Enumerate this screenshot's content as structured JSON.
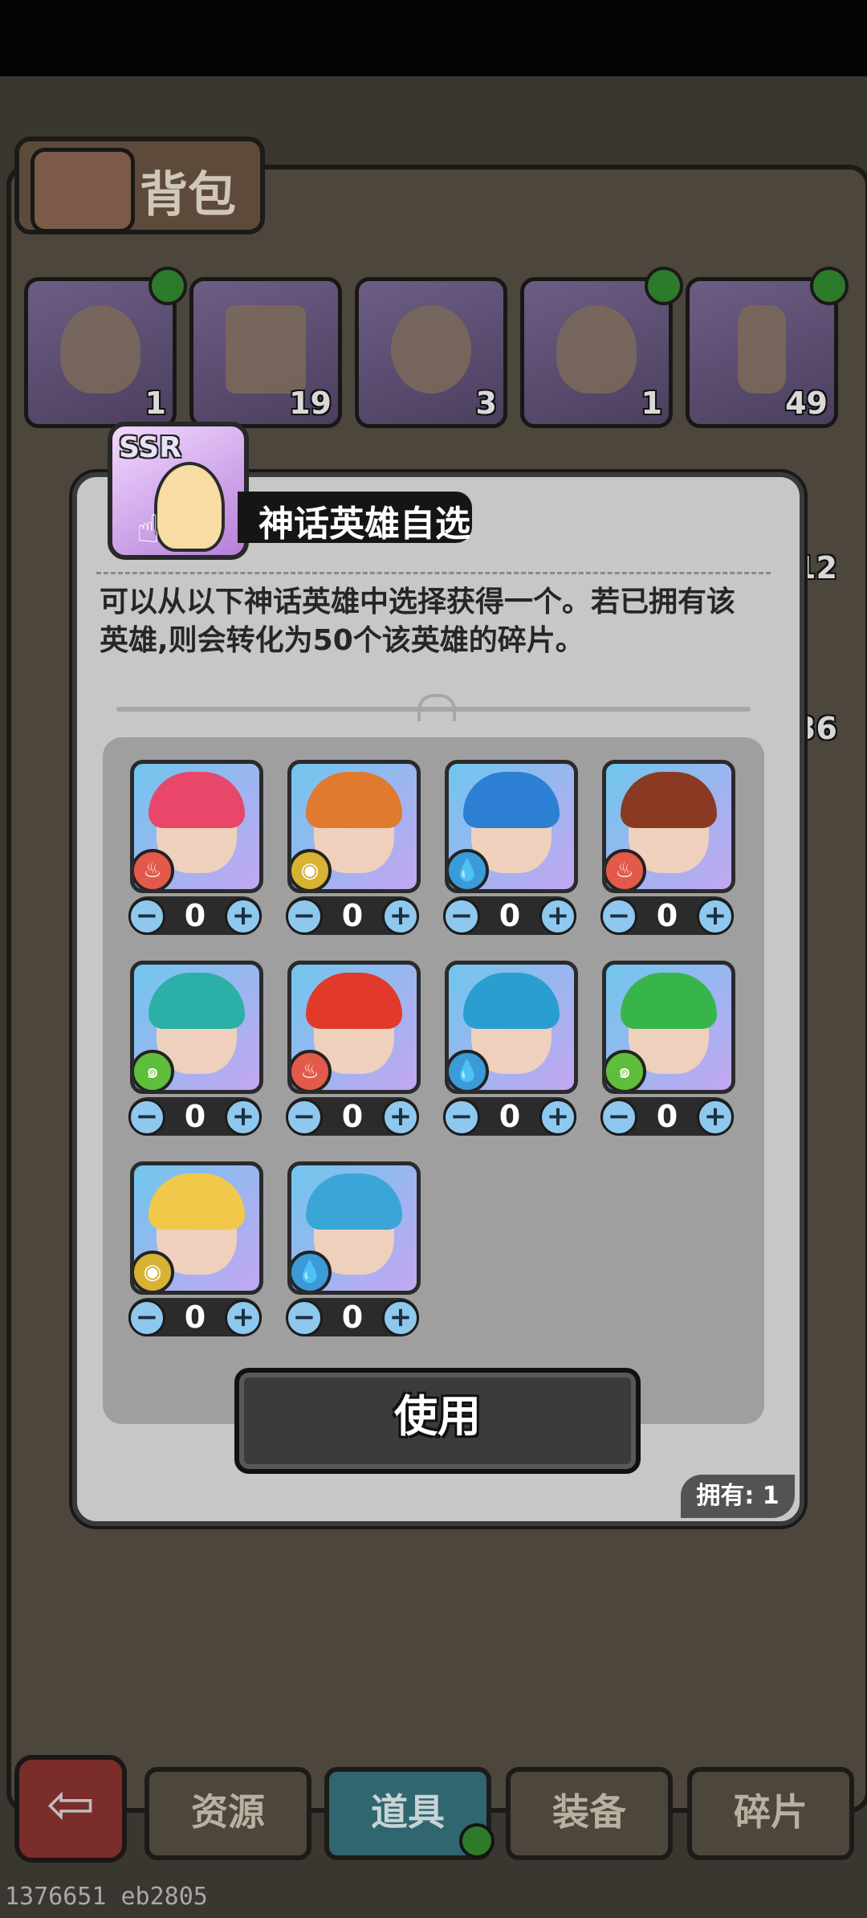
{
  "bag": {
    "title": "背包",
    "items": [
      {
        "count": "1"
      },
      {
        "count": "19"
      },
      {
        "count": "3"
      },
      {
        "count": "1"
      },
      {
        "count": "49"
      }
    ],
    "side_counts": [
      "12",
      "36"
    ]
  },
  "nav": {
    "back_icon": "back-arrow-icon",
    "tabs": [
      "资源",
      "道具",
      "装备",
      "碎片"
    ],
    "active_tab": "道具"
  },
  "dialog": {
    "badge": "SSR",
    "title": "神话英雄自选",
    "description": "可以从以下神话英雄中选择获得一个。若已拥有该英雄,则会转化为50个该英雄的碎片。",
    "use_button": "使用",
    "owned": "拥有: 1",
    "heroes": [
      {
        "element": "fire",
        "element_icon": "flame",
        "hair_color": "#e8476a",
        "quantity": "0"
      },
      {
        "element": "earth",
        "element_icon": "rock",
        "hair_color": "#e07a2e",
        "quantity": "0"
      },
      {
        "element": "water",
        "element_icon": "droplet",
        "hair_color": "#2d7fd3",
        "quantity": "0"
      },
      {
        "element": "fire",
        "element_icon": "flame",
        "hair_color": "#8a3a22",
        "quantity": "0"
      },
      {
        "element": "wind",
        "element_icon": "swirl",
        "hair_color": "#2bb0a8",
        "quantity": "0"
      },
      {
        "element": "fire",
        "element_icon": "flame",
        "hair_color": "#e23a2a",
        "quantity": "0"
      },
      {
        "element": "water",
        "element_icon": "droplet",
        "hair_color": "#2a9ed0",
        "quantity": "0"
      },
      {
        "element": "wind",
        "element_icon": "swirl",
        "hair_color": "#37b54b",
        "quantity": "0"
      },
      {
        "element": "earth",
        "element_icon": "rock",
        "hair_color": "#f2c84a",
        "quantity": "0"
      },
      {
        "element": "water",
        "element_icon": "droplet",
        "hair_color": "#3aa6d8",
        "quantity": "0"
      }
    ]
  },
  "watermark": "1376651 eb2805",
  "colors": {
    "fire": "#e35a4a",
    "earth": "#d7b233",
    "water": "#3b9ad8",
    "wind": "#5fbf3c",
    "notification": "#2e7a2b"
  }
}
